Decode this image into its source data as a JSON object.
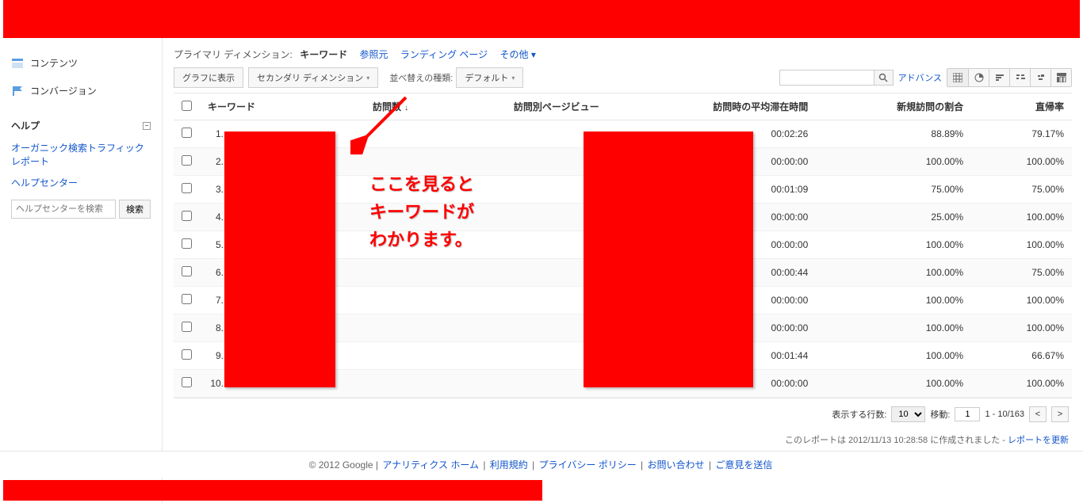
{
  "sidebar": {
    "items": [
      {
        "label": "コンテンツ"
      },
      {
        "label": "コンバージョン"
      }
    ],
    "help_title": "ヘルプ",
    "help_links": [
      "オーガニック検索トラフィック レポート",
      "ヘルプセンター"
    ],
    "help_search_placeholder": "ヘルプセンターを検索",
    "help_search_btn": "検索"
  },
  "dimension": {
    "label": "プライマリ ディメンション:",
    "selected": "キーワード",
    "options": [
      "参照元",
      "ランディング ページ",
      "その他"
    ]
  },
  "toolbar": {
    "chart_btn": "グラフに表示",
    "secondary_btn": "セカンダリ ディメンション",
    "sort_label": "並べ替えの種類:",
    "sort_value": "デフォルト",
    "advanced": "アドバンス"
  },
  "table": {
    "headers": {
      "keyword": "キーワード",
      "visits": "訪問数",
      "pages_per_visit": "訪問別ページビュー",
      "avg_time": "訪問時の平均滞在時間",
      "new_visit_pct": "新規訪問の割合",
      "bounce": "直帰率"
    },
    "rows": [
      {
        "n": "1.",
        "time": "00:02:26",
        "newpct": "88.89%",
        "bounce": "79.17%"
      },
      {
        "n": "2.",
        "time": "00:00:00",
        "newpct": "100.00%",
        "bounce": "100.00%"
      },
      {
        "n": "3.",
        "time": "00:01:09",
        "newpct": "75.00%",
        "bounce": "75.00%"
      },
      {
        "n": "4.",
        "time": "00:00:00",
        "newpct": "25.00%",
        "bounce": "100.00%"
      },
      {
        "n": "5.",
        "time": "00:00:00",
        "newpct": "100.00%",
        "bounce": "100.00%"
      },
      {
        "n": "6.",
        "time": "00:00:44",
        "newpct": "100.00%",
        "bounce": "75.00%"
      },
      {
        "n": "7.",
        "time": "00:00:00",
        "newpct": "100.00%",
        "bounce": "100.00%"
      },
      {
        "n": "8.",
        "time": "00:00:00",
        "newpct": "100.00%",
        "bounce": "100.00%"
      },
      {
        "n": "9.",
        "time": "00:01:44",
        "newpct": "100.00%",
        "bounce": "66.67%"
      },
      {
        "n": "10.",
        "time": "00:00:00",
        "newpct": "100.00%",
        "bounce": "100.00%"
      }
    ]
  },
  "pager": {
    "rows_label": "表示する行数:",
    "rows_value": "10",
    "goto_label": "移動:",
    "goto_value": "1",
    "range": "1 - 10/163"
  },
  "report_info": {
    "prefix": "このレポートは 2012/11/13 10:28:58 に作成されました -",
    "refresh": "レポートを更新"
  },
  "footer": {
    "copyright": "© 2012 Google",
    "links": [
      "アナリティクス ホーム",
      "利用規約",
      "プライバシー ポリシー",
      "お問い合わせ",
      "ご意見を送信"
    ]
  },
  "annotation": "ここを見ると\nキーワードが\nわかります。"
}
